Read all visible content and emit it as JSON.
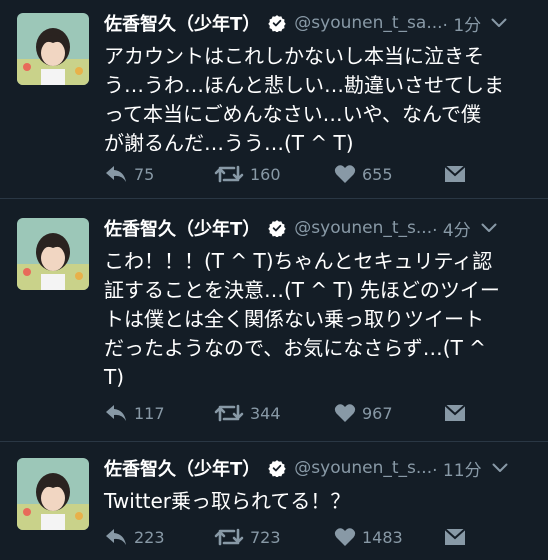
{
  "tweets": [
    {
      "name": "佐香智久（少年T）",
      "handle": "@syounen_t_sa...",
      "time": "· 1分",
      "text": "アカウントはこれしかないし本当に泣きそ\nう…うわ…ほんと悲しい…勘違いさせてしま\nって本当にごめんなさい…いや、なんで僕\nが謝るんだ…うう…(T ^ T)",
      "replies": "75",
      "retweets": "160",
      "likes": "655"
    },
    {
      "name": "佐香智久（少年T）",
      "handle": "@syounen_t_s...",
      "time": "· 4分",
      "text": "こわ！！！(T ^ T)ちゃんとセキュリティ認\n証することを決意…(T ^ T) 先ほどのツイー\nトは僕とは全く関係ない乗っ取りツイート\nだったようなので、お気になさらず…(T ^\nT)",
      "replies": "117",
      "retweets": "344",
      "likes": "967"
    },
    {
      "name": "佐香智久（少年T）",
      "handle": "@syounen_t_s...",
      "time": "· 11分",
      "text": "Twitter乗っ取られてる！？",
      "replies": "223",
      "retweets": "723",
      "likes": "1483"
    }
  ],
  "icons": {
    "verified": "verified-badge-icon",
    "more": "chevron-down-icon",
    "reply": "reply-arrow-icon",
    "retweet": "retweet-icon",
    "like": "heart-icon",
    "dm": "envelope-icon"
  },
  "colors": {
    "background": "#141d26",
    "secondary_text": "#8899a6",
    "divider": "#2a3744"
  }
}
